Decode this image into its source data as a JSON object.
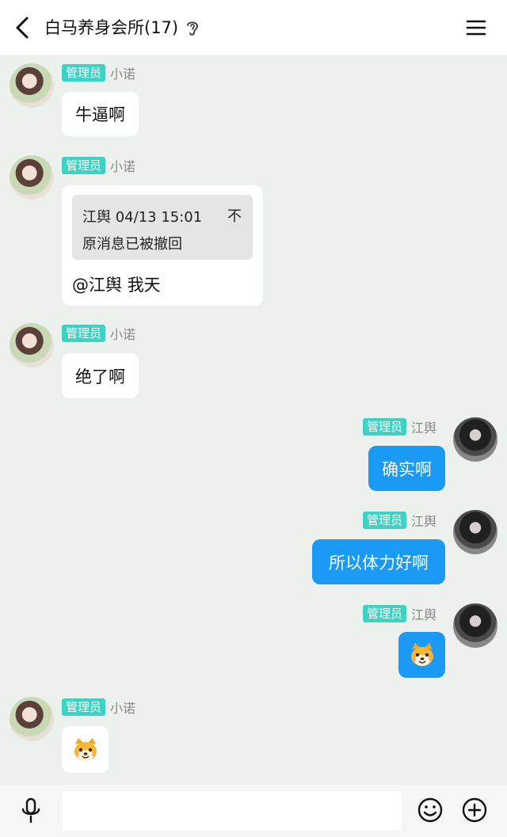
{
  "header": {
    "title": "白马养身会所(17)",
    "back_icon": "chevron-left-icon",
    "ear_icon": "ear-icon",
    "menu_icon": "hamburger-menu-icon"
  },
  "messages": [
    {
      "side": "left",
      "badge": "管理员",
      "nick": "小诺",
      "text": "牛逼啊"
    },
    {
      "side": "left",
      "badge": "管理员",
      "nick": "小诺",
      "quote": {
        "author_time": "江舆 04/13 15:01",
        "close": "不",
        "body": "原消息已被撤回"
      },
      "text": "@江舆 我天"
    },
    {
      "side": "left",
      "badge": "管理员",
      "nick": "小诺",
      "text": "绝了啊"
    },
    {
      "side": "right",
      "badge": "管理员",
      "nick": "江舆",
      "text": "确实啊"
    },
    {
      "side": "right",
      "badge": "管理员",
      "nick": "江舆",
      "text": "所以体力好啊"
    },
    {
      "side": "right",
      "badge": "管理员",
      "nick": "江舆",
      "sticker": "dog-face-emoji"
    },
    {
      "side": "left",
      "badge": "管理员",
      "nick": "小诺",
      "sticker": "dog-face-emoji"
    }
  ],
  "input": {
    "placeholder": "",
    "mic_icon": "microphone-icon",
    "emoji_icon": "smiley-icon",
    "plus_icon": "plus-circle-icon"
  },
  "colors": {
    "badge": "#3dd2c4",
    "my_bubble": "#1a9af5",
    "chat_bg": "#edf1ee"
  }
}
